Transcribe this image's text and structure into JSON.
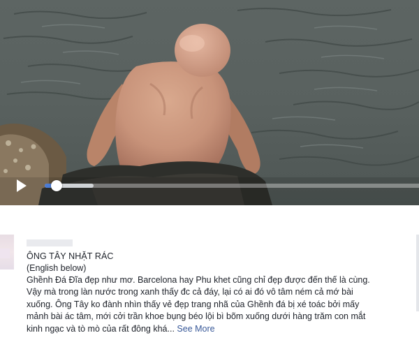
{
  "video": {
    "controls": {
      "play_icon": "play-icon",
      "progress_fraction": 0.025,
      "buffered_fraction": 0.13
    }
  },
  "post": {
    "title": "ÔNG TÂY NHẶT RÁC",
    "subtitle": "(English below)",
    "body_lines": [
      "Ghềnh Đá Đĩa đẹp như mơ. Barcelona hay Phu khet cũng chỉ đẹp được đến thế là cùng.",
      "Vậy mà trong làn nước trong xanh thấy đc cả đáy, lại có ai đó vô tâm ném cả mớ bài",
      "xuống. Ông Tây ko đành nhìn thấy vẻ đẹp trang nhã của Ghềnh đá bị xé toác bởi mấy",
      "mảnh bài ác tâm, mới cởi trần khoe bụng béo lội bì bõm xuống dưới hàng trăm con mắt",
      "kinh ngạc và tò mò của rất đông khá..."
    ],
    "see_more": "See More"
  },
  "colors": {
    "progress_played": "#4b7bd4",
    "link": "#385898",
    "text": "#1d2129"
  }
}
